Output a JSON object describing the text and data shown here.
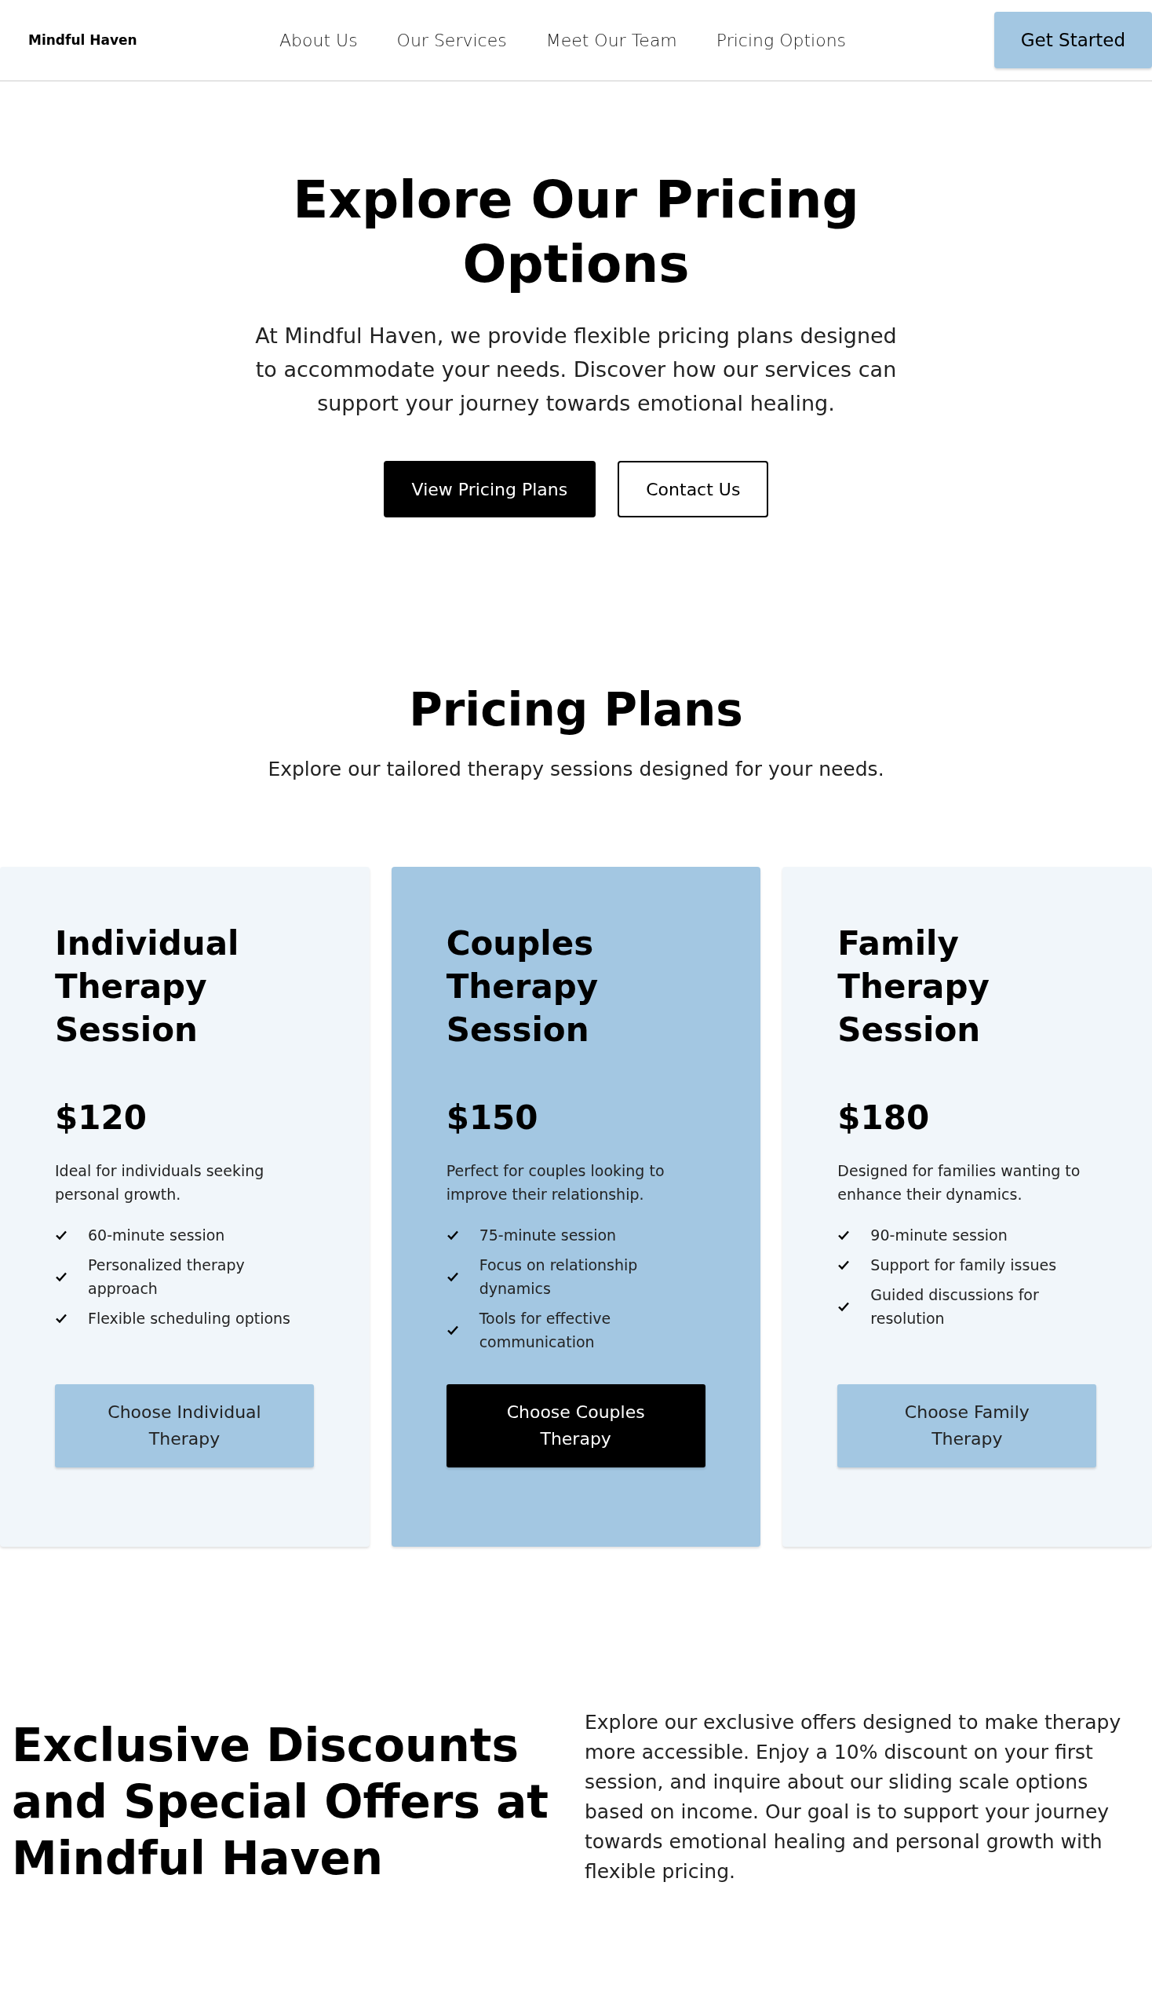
{
  "header": {
    "logo": "Mindful Haven",
    "nav": [
      "About Us",
      "Our Services",
      "Meet Our Team",
      "Pricing Options"
    ],
    "cta": "Get Started"
  },
  "hero": {
    "title": "Explore Our Pricing Options",
    "text": "At Mindful Haven, we provide flexible pricing plans designed to accommodate your needs. Discover how our services can support your journey towards emotional healing.",
    "buttons": [
      {
        "label": "View Pricing Plans",
        "kind": "primary"
      },
      {
        "label": "Contact Us",
        "kind": "outline"
      }
    ]
  },
  "pricing": {
    "title": "Pricing Plans",
    "subtitle": "Explore our tailored therapy sessions designed for your needs.",
    "plans": [
      {
        "name": "Individual Therapy Session",
        "price": "$120",
        "description": "Ideal for individuals seeking personal growth.",
        "features": [
          "60-minute session",
          "Personalized therapy approach",
          "Flexible scheduling options"
        ],
        "button": "Choose Individual Therapy",
        "highlighted": false
      },
      {
        "name": "Couples Therapy Session",
        "price": "$150",
        "description": "Perfect for couples looking to improve their relationship.",
        "features": [
          "75-minute session",
          "Focus on relationship dynamics",
          "Tools for effective communication"
        ],
        "button": "Choose Couples Therapy",
        "highlighted": true
      },
      {
        "name": "Family Therapy Session",
        "price": "$180",
        "description": "Designed for families wanting to enhance their dynamics.",
        "features": [
          "90-minute session",
          "Support for family issues",
          "Guided discussions for resolution"
        ],
        "button": "Choose Family Therapy",
        "highlighted": false
      }
    ]
  },
  "offers": {
    "title": "Exclusive Discounts and Special Offers at Mindful Haven",
    "text": "Explore our exclusive offers designed to make therapy more accessible. Enjoy a 10% discount on your first session, and inquire about our sliding scale options based on income. Our goal is to support your journey towards emotional healing and personal growth with flexible pricing."
  }
}
